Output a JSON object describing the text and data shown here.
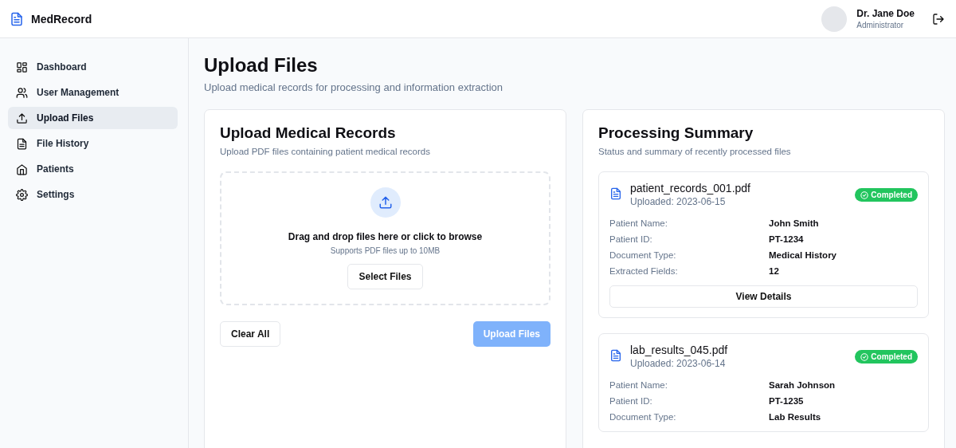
{
  "app": {
    "name": "MedRecord"
  },
  "user": {
    "name": "Dr. Jane Doe",
    "role": "Administrator"
  },
  "sidebar": {
    "items": [
      {
        "label": "Dashboard",
        "selected": false
      },
      {
        "label": "User Management",
        "selected": false
      },
      {
        "label": "Upload Files",
        "selected": true
      },
      {
        "label": "File History",
        "selected": false
      },
      {
        "label": "Patients",
        "selected": false
      },
      {
        "label": "Settings",
        "selected": false
      }
    ]
  },
  "page": {
    "title": "Upload Files",
    "subtitle": "Upload medical records for processing and information extraction"
  },
  "upload": {
    "title": "Upload Medical Records",
    "subtitle": "Upload PDF files containing patient medical records",
    "drop_text": "Drag and drop files here or click to browse",
    "drop_hint": "Supports PDF files up to 10MB",
    "select_button": "Select Files",
    "clear_button": "Clear All",
    "upload_button": {
      "label": "Upload Files",
      "disabled": true
    }
  },
  "summary": {
    "title": "Processing Summary",
    "subtitle": "Status and summary of recently processed files",
    "files": [
      {
        "name": "patient_records_001.pdf",
        "uploaded": "Uploaded: 2023-06-15",
        "status": {
          "kind": "completed",
          "label": "Completed"
        },
        "fields": [
          {
            "label": "Patient Name:",
            "value": "John Smith"
          },
          {
            "label": "Patient ID:",
            "value": "PT-1234"
          },
          {
            "label": "Document Type:",
            "value": "Medical History"
          },
          {
            "label": "Extracted Fields:",
            "value": "12"
          }
        ],
        "button": "View Details"
      },
      {
        "name": "lab_results_045.pdf",
        "uploaded": "Uploaded: 2023-06-14",
        "status": {
          "kind": "completed",
          "label": "Completed"
        },
        "fields": [
          {
            "label": "Patient Name:",
            "value": "Sarah Johnson"
          },
          {
            "label": "Patient ID:",
            "value": "PT-1235"
          },
          {
            "label": "Document Type:",
            "value": "Lab Results"
          }
        ]
      }
    ]
  }
}
